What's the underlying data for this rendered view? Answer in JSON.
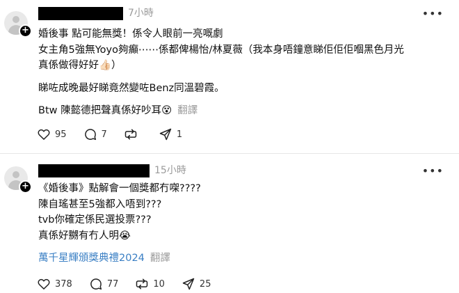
{
  "posts": [
    {
      "time": "7小時",
      "lines": [
        "婚後事 點可能無獎！係令人眼前一亮嘅劇",
        "女主角5強無Yoyo夠癲⋯⋯係都俾楊怡/林夏薇（我本身唔鐘意睇佢佢佢嗰黑色月光",
        "真係做得好好👍🏻）",
        "睇咗成晚最好睇竟然變咗Benz同溫碧霞。",
        "Btw 陳懿德把聲真係好吵耳😵"
      ],
      "translate_label": "翻譯",
      "likes": "95",
      "comments": "7",
      "reposts": "",
      "shares": "1"
    },
    {
      "time": "15小時",
      "lines": [
        "《婚後事》點解會一個獎都冇㗎????",
        "陳自瑤甚至5強都入唔到???",
        "tvb你確定係民選投票???",
        "真係好嬲有冇人明😭"
      ],
      "hashtag": "萬千星輝頒獎典禮2024",
      "translate_label": "翻譯",
      "likes": "378",
      "comments": "77",
      "reposts": "10",
      "shares": "25"
    }
  ],
  "icons": [
    "avatar-icon",
    "plus-icon",
    "more-icon",
    "heart-icon",
    "comment-icon",
    "repost-icon",
    "share-icon"
  ]
}
